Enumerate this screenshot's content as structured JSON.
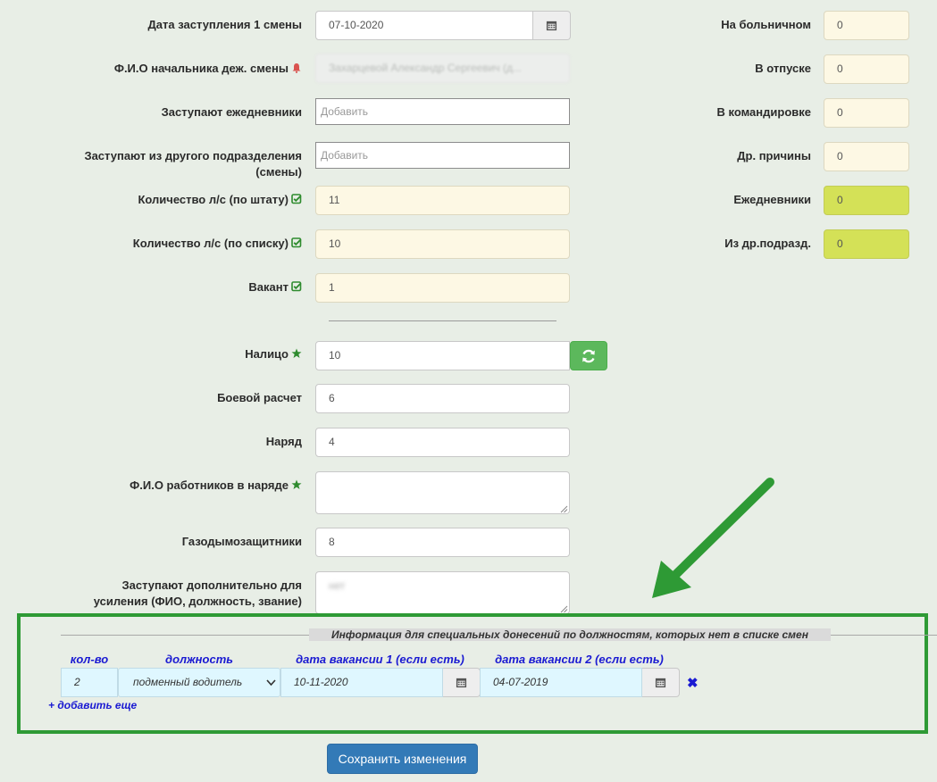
{
  "form": {
    "date_label": "Дата заступления 1 смены",
    "date_value": "07-10-2020",
    "chief_label": "Ф.И.О начальника деж. смены",
    "chief_value": "Захарцевой Александр Сергеевич (д...",
    "daily_label": "Заступают ежедневники",
    "daily_placeholder": "Добавить",
    "other_unit_label_1": "Заступают из другого подразделения",
    "other_unit_label_2": "(смены)",
    "other_unit_placeholder": "Добавить",
    "staff_label": "Количество л/с (по штату)",
    "staff_value": "11",
    "list_label": "Количество л/с (по списку)",
    "list_value": "10",
    "vacant_label": "Вакант",
    "vacant_value": "1",
    "present_label": "Налицо",
    "present_value": "10",
    "combat_label": "Боевой расчет",
    "combat_value": "6",
    "duty_label": "Наряд",
    "duty_value": "4",
    "duty_names_label": "Ф.И.О работников в наряде",
    "duty_names_value": "",
    "gas_label": "Газодымозащитники",
    "gas_value": "8",
    "extra_label_1": "Заступают дополнительно для",
    "extra_label_2": "усиления (ФИО, должность, звание)",
    "extra_value": "нет"
  },
  "right": {
    "sick_label": "На больничном",
    "sick_value": "0",
    "vacation_label": "В отпуске",
    "vacation_value": "0",
    "trip_label": "В командировке",
    "trip_value": "0",
    "other_label": "Др. причины",
    "other_value": "0",
    "daily_label": "Ежедневники",
    "daily_value": "0",
    "other_unit_label": "Из др.подразд.",
    "other_unit_value": "0"
  },
  "special": {
    "legend": "Информация для специальных донесений по должностям, которых нет в списке смен",
    "col_count": "кол-во",
    "col_position": "должность",
    "col_vacancy1": "дата вакансии 1 (если есть)",
    "col_vacancy2": "дата вакансии 2 (если есть)",
    "row_count": "2",
    "row_position": "подменный водитель",
    "row_vacancy1": "10-11-2020",
    "row_vacancy2": "04-07-2019",
    "remove": "✖",
    "add_more": "+ добавить еще"
  },
  "save_label": "Сохранить изменения",
  "colors": {
    "highlight_border": "#2e9a35",
    "primary": "#337ab7",
    "success": "#5cb85c",
    "link": "#1a1ad2"
  }
}
